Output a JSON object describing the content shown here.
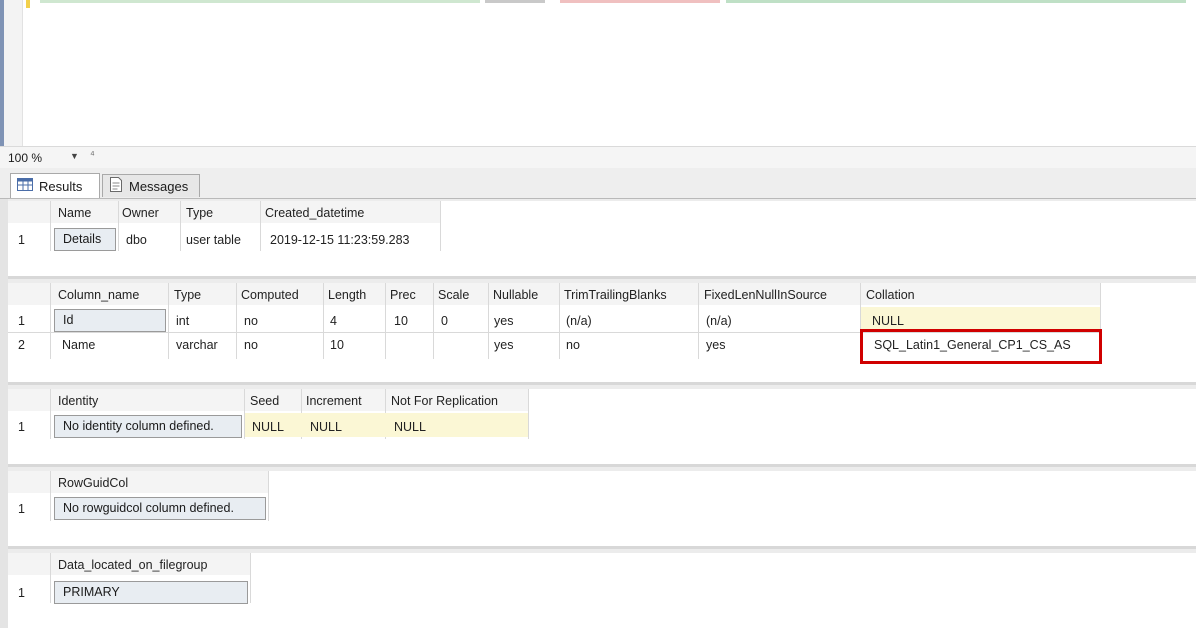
{
  "zoom": {
    "value": "100 %"
  },
  "tabs": [
    {
      "label": "Results",
      "active": true
    },
    {
      "label": "Messages",
      "active": false
    }
  ],
  "grid1": {
    "columns": [
      "Name",
      "Owner",
      "Type",
      "Created_datetime"
    ],
    "rows": [
      {
        "num": "1",
        "cells": [
          "Details",
          "dbo",
          "user table",
          "2019-12-15 11:23:59.283"
        ]
      }
    ]
  },
  "grid2": {
    "columns": [
      "Column_name",
      "Type",
      "Computed",
      "Length",
      "Prec",
      "Scale",
      "Nullable",
      "TrimTrailingBlanks",
      "FixedLenNullInSource",
      "Collation"
    ],
    "rows": [
      {
        "num": "1",
        "cells": [
          "Id",
          "int",
          "no",
          "4",
          "10",
          "0",
          "yes",
          "(n/a)",
          "(n/a)",
          "NULL"
        ]
      },
      {
        "num": "2",
        "cells": [
          "Name",
          "varchar",
          "no",
          "10",
          "",
          "",
          "yes",
          "no",
          "yes",
          "SQL_Latin1_General_CP1_CS_AS"
        ]
      }
    ]
  },
  "grid3": {
    "columns": [
      "Identity",
      "Seed",
      "Increment",
      "Not For Replication"
    ],
    "rows": [
      {
        "num": "1",
        "cells": [
          "No identity column defined.",
          "NULL",
          "NULL",
          "NULL"
        ]
      }
    ]
  },
  "grid4": {
    "columns": [
      "RowGuidCol"
    ],
    "rows": [
      {
        "num": "1",
        "cells": [
          "No rowguidcol column defined."
        ]
      }
    ]
  },
  "grid5": {
    "columns": [
      "Data_located_on_filegroup"
    ],
    "rows": [
      {
        "num": "1",
        "cells": [
          "PRIMARY"
        ]
      }
    ]
  },
  "colors": {
    "highlight": "#d00000",
    "selected_cell": "#e8edf2",
    "null_cell": "#fbf7d5"
  },
  "icons": {
    "results_tab": "grid-icon",
    "messages_tab": "document-icon",
    "zoom_dropdown": "chevron-down-icon"
  }
}
